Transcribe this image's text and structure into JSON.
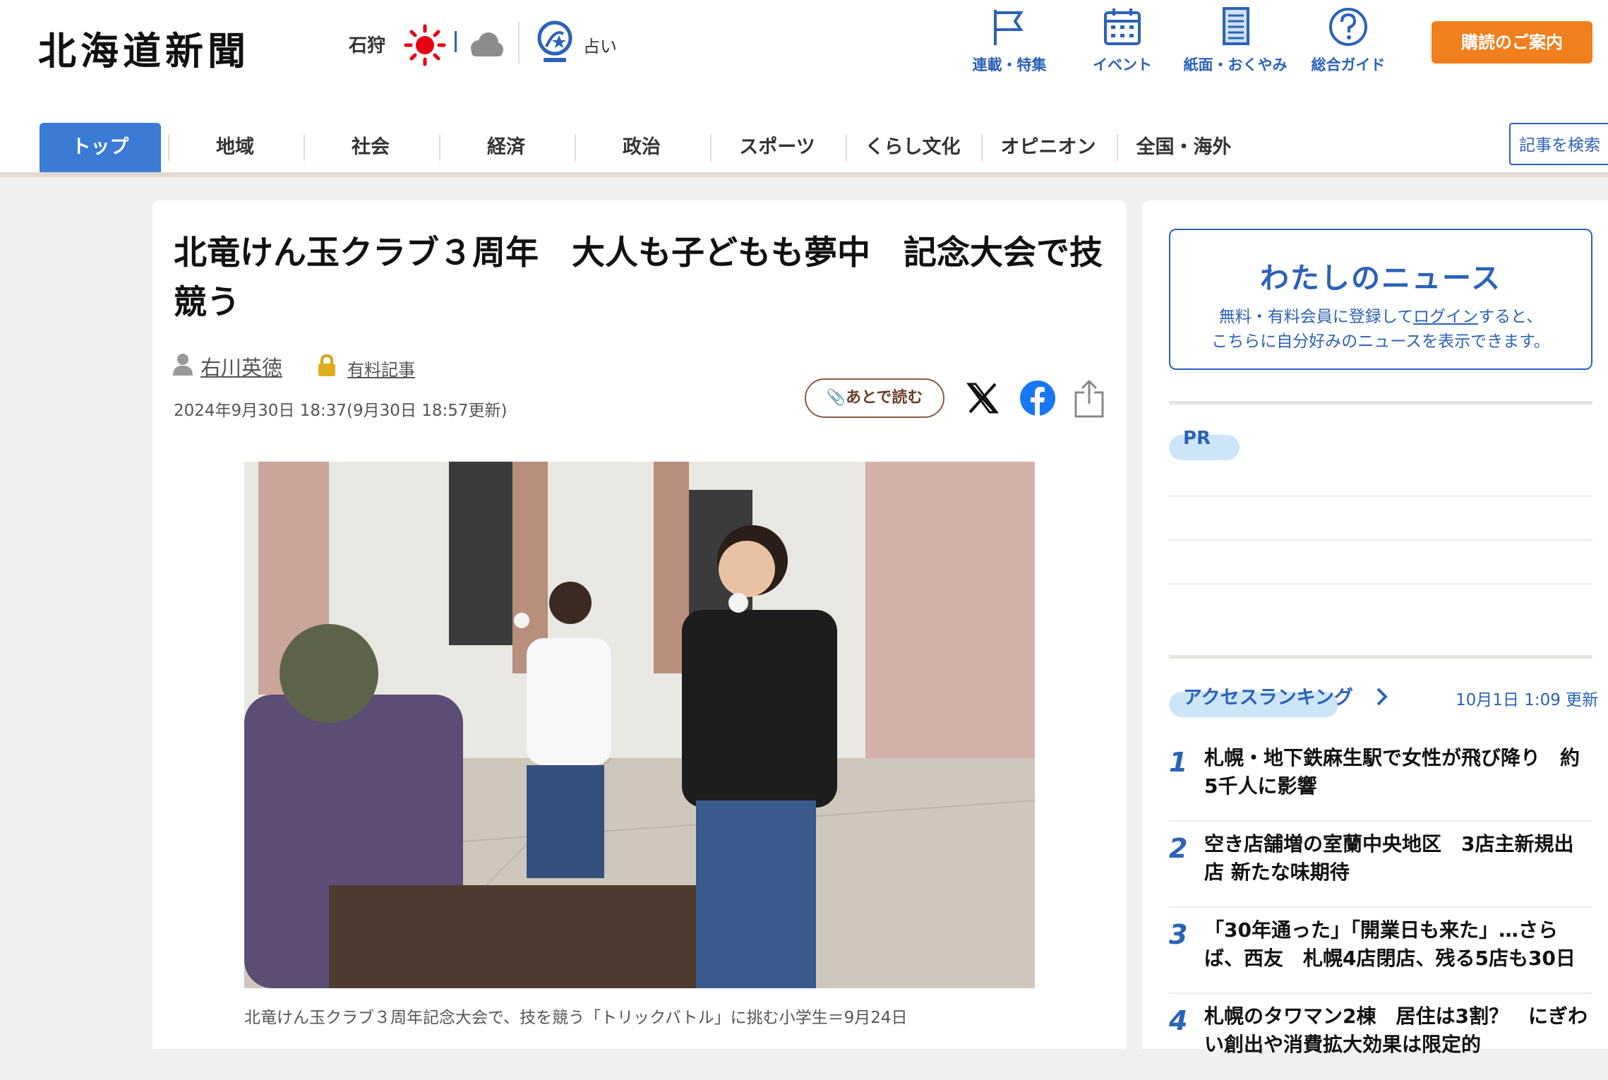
{
  "header": {
    "logo": "北海道新聞",
    "region": "石狩",
    "fortune_label": "占い",
    "nav_icons": [
      {
        "label": "連載・特集",
        "icon": "flag-icon"
      },
      {
        "label": "イベント",
        "icon": "calendar-icon"
      },
      {
        "label": "紙面・おくやみ",
        "icon": "newspaper-icon"
      },
      {
        "label": "総合ガイド",
        "icon": "help-icon"
      }
    ],
    "subscribe_label": "購読のご案内",
    "search_label": "記事を検索"
  },
  "nav": {
    "items": [
      "トップ",
      "地域",
      "社会",
      "経済",
      "政治",
      "スポーツ",
      "くらし文化",
      "オピニオン",
      "全国・海外"
    ],
    "active": "トップ"
  },
  "article": {
    "title": "北竜けん玉クラブ３周年　大人も子どもも夢中　記念大会で技競う",
    "author": "右川英徳",
    "paid_label": "有料記事",
    "date": "2024年9月30日 18:37(9月30日 18:57更新)",
    "read_later": "あとで読む",
    "caption": "北竜けん玉クラブ３周年記念大会で、技を競う「トリックバトル」に挑む小学生＝9月24日"
  },
  "sidebar": {
    "mynews": {
      "title": "わたしのニュース",
      "line1_pre": "無料・有料会員に登録して",
      "login": "ログイン",
      "line1_post": "すると、",
      "line2": "こちらに自分好みのニュースを表示できます。"
    },
    "pr_label": "PR",
    "ranking": {
      "title": "アクセスランキング",
      "updated": "10月1日 1:09 更新",
      "items": [
        {
          "rank": "1",
          "text": "札幌・地下鉄麻生駅で女性が飛び降り　約5千人に影響"
        },
        {
          "rank": "2",
          "text": "空き店舗増の室蘭中央地区　3店主新規出店 新たな味期待"
        },
        {
          "rank": "3",
          "text": "「30年通った」「開業日も来た」…さらば、西友　札幌4店閉店、残る5店も30日"
        },
        {
          "rank": "4",
          "text": "札幌のタワマン2棟　居住は3割？　にぎわい創出や消費拡大効果は限定的"
        }
      ]
    }
  },
  "colors": {
    "brand_blue": "#2b62b8",
    "nav_active": "#3b7bd6",
    "subscribe": "#f07f1e"
  }
}
